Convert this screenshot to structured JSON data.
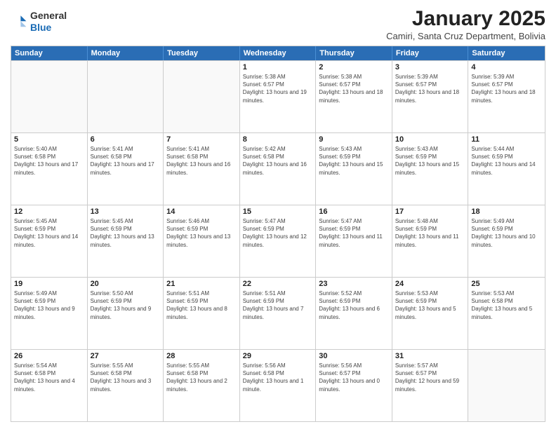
{
  "header": {
    "logo": {
      "line1": "General",
      "line2": "Blue"
    },
    "title": "January 2025",
    "subtitle": "Camiri, Santa Cruz Department, Bolivia"
  },
  "weekdays": [
    "Sunday",
    "Monday",
    "Tuesday",
    "Wednesday",
    "Thursday",
    "Friday",
    "Saturday"
  ],
  "rows": [
    [
      {
        "day": "",
        "sunrise": "",
        "sunset": "",
        "daylight": ""
      },
      {
        "day": "",
        "sunrise": "",
        "sunset": "",
        "daylight": ""
      },
      {
        "day": "",
        "sunrise": "",
        "sunset": "",
        "daylight": ""
      },
      {
        "day": "1",
        "sunrise": "Sunrise: 5:38 AM",
        "sunset": "Sunset: 6:57 PM",
        "daylight": "Daylight: 13 hours and 19 minutes."
      },
      {
        "day": "2",
        "sunrise": "Sunrise: 5:38 AM",
        "sunset": "Sunset: 6:57 PM",
        "daylight": "Daylight: 13 hours and 18 minutes."
      },
      {
        "day": "3",
        "sunrise": "Sunrise: 5:39 AM",
        "sunset": "Sunset: 6:57 PM",
        "daylight": "Daylight: 13 hours and 18 minutes."
      },
      {
        "day": "4",
        "sunrise": "Sunrise: 5:39 AM",
        "sunset": "Sunset: 6:57 PM",
        "daylight": "Daylight: 13 hours and 18 minutes."
      }
    ],
    [
      {
        "day": "5",
        "sunrise": "Sunrise: 5:40 AM",
        "sunset": "Sunset: 6:58 PM",
        "daylight": "Daylight: 13 hours and 17 minutes."
      },
      {
        "day": "6",
        "sunrise": "Sunrise: 5:41 AM",
        "sunset": "Sunset: 6:58 PM",
        "daylight": "Daylight: 13 hours and 17 minutes."
      },
      {
        "day": "7",
        "sunrise": "Sunrise: 5:41 AM",
        "sunset": "Sunset: 6:58 PM",
        "daylight": "Daylight: 13 hours and 16 minutes."
      },
      {
        "day": "8",
        "sunrise": "Sunrise: 5:42 AM",
        "sunset": "Sunset: 6:58 PM",
        "daylight": "Daylight: 13 hours and 16 minutes."
      },
      {
        "day": "9",
        "sunrise": "Sunrise: 5:43 AM",
        "sunset": "Sunset: 6:59 PM",
        "daylight": "Daylight: 13 hours and 15 minutes."
      },
      {
        "day": "10",
        "sunrise": "Sunrise: 5:43 AM",
        "sunset": "Sunset: 6:59 PM",
        "daylight": "Daylight: 13 hours and 15 minutes."
      },
      {
        "day": "11",
        "sunrise": "Sunrise: 5:44 AM",
        "sunset": "Sunset: 6:59 PM",
        "daylight": "Daylight: 13 hours and 14 minutes."
      }
    ],
    [
      {
        "day": "12",
        "sunrise": "Sunrise: 5:45 AM",
        "sunset": "Sunset: 6:59 PM",
        "daylight": "Daylight: 13 hours and 14 minutes."
      },
      {
        "day": "13",
        "sunrise": "Sunrise: 5:45 AM",
        "sunset": "Sunset: 6:59 PM",
        "daylight": "Daylight: 13 hours and 13 minutes."
      },
      {
        "day": "14",
        "sunrise": "Sunrise: 5:46 AM",
        "sunset": "Sunset: 6:59 PM",
        "daylight": "Daylight: 13 hours and 13 minutes."
      },
      {
        "day": "15",
        "sunrise": "Sunrise: 5:47 AM",
        "sunset": "Sunset: 6:59 PM",
        "daylight": "Daylight: 13 hours and 12 minutes."
      },
      {
        "day": "16",
        "sunrise": "Sunrise: 5:47 AM",
        "sunset": "Sunset: 6:59 PM",
        "daylight": "Daylight: 13 hours and 11 minutes."
      },
      {
        "day": "17",
        "sunrise": "Sunrise: 5:48 AM",
        "sunset": "Sunset: 6:59 PM",
        "daylight": "Daylight: 13 hours and 11 minutes."
      },
      {
        "day": "18",
        "sunrise": "Sunrise: 5:49 AM",
        "sunset": "Sunset: 6:59 PM",
        "daylight": "Daylight: 13 hours and 10 minutes."
      }
    ],
    [
      {
        "day": "19",
        "sunrise": "Sunrise: 5:49 AM",
        "sunset": "Sunset: 6:59 PM",
        "daylight": "Daylight: 13 hours and 9 minutes."
      },
      {
        "day": "20",
        "sunrise": "Sunrise: 5:50 AM",
        "sunset": "Sunset: 6:59 PM",
        "daylight": "Daylight: 13 hours and 9 minutes."
      },
      {
        "day": "21",
        "sunrise": "Sunrise: 5:51 AM",
        "sunset": "Sunset: 6:59 PM",
        "daylight": "Daylight: 13 hours and 8 minutes."
      },
      {
        "day": "22",
        "sunrise": "Sunrise: 5:51 AM",
        "sunset": "Sunset: 6:59 PM",
        "daylight": "Daylight: 13 hours and 7 minutes."
      },
      {
        "day": "23",
        "sunrise": "Sunrise: 5:52 AM",
        "sunset": "Sunset: 6:59 PM",
        "daylight": "Daylight: 13 hours and 6 minutes."
      },
      {
        "day": "24",
        "sunrise": "Sunrise: 5:53 AM",
        "sunset": "Sunset: 6:59 PM",
        "daylight": "Daylight: 13 hours and 5 minutes."
      },
      {
        "day": "25",
        "sunrise": "Sunrise: 5:53 AM",
        "sunset": "Sunset: 6:58 PM",
        "daylight": "Daylight: 13 hours and 5 minutes."
      }
    ],
    [
      {
        "day": "26",
        "sunrise": "Sunrise: 5:54 AM",
        "sunset": "Sunset: 6:58 PM",
        "daylight": "Daylight: 13 hours and 4 minutes."
      },
      {
        "day": "27",
        "sunrise": "Sunrise: 5:55 AM",
        "sunset": "Sunset: 6:58 PM",
        "daylight": "Daylight: 13 hours and 3 minutes."
      },
      {
        "day": "28",
        "sunrise": "Sunrise: 5:55 AM",
        "sunset": "Sunset: 6:58 PM",
        "daylight": "Daylight: 13 hours and 2 minutes."
      },
      {
        "day": "29",
        "sunrise": "Sunrise: 5:56 AM",
        "sunset": "Sunset: 6:58 PM",
        "daylight": "Daylight: 13 hours and 1 minute."
      },
      {
        "day": "30",
        "sunrise": "Sunrise: 5:56 AM",
        "sunset": "Sunset: 6:57 PM",
        "daylight": "Daylight: 13 hours and 0 minutes."
      },
      {
        "day": "31",
        "sunrise": "Sunrise: 5:57 AM",
        "sunset": "Sunset: 6:57 PM",
        "daylight": "Daylight: 12 hours and 59 minutes."
      },
      {
        "day": "",
        "sunrise": "",
        "sunset": "",
        "daylight": ""
      }
    ]
  ]
}
